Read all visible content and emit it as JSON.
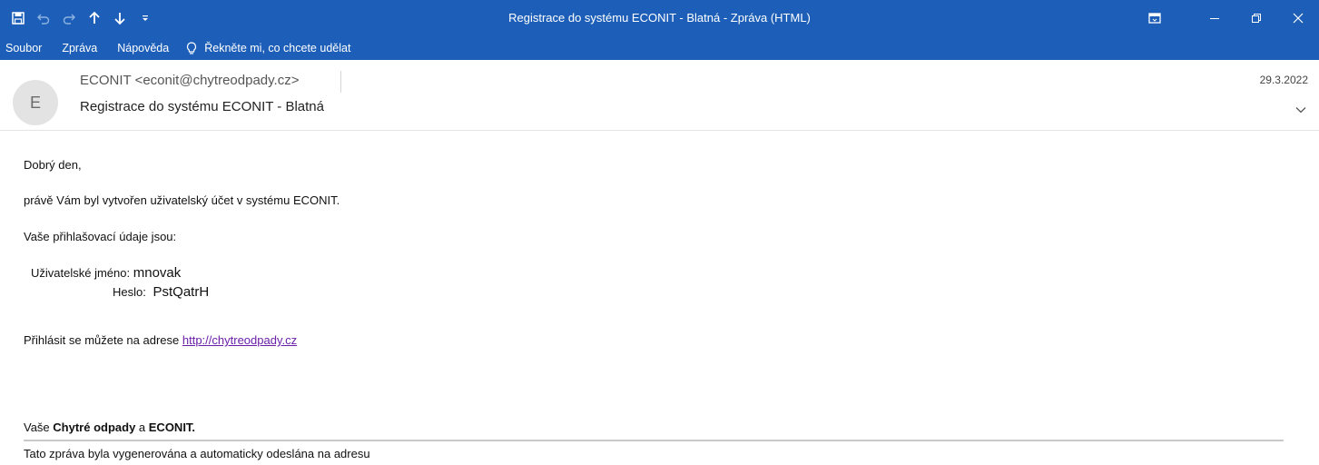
{
  "window": {
    "title": "Registrace do systému ECONIT - Blatná  -  Zpráva (HTML)"
  },
  "quick_access": {
    "save_icon": "save-icon",
    "undo_icon": "undo-icon",
    "redo_icon": "redo-icon",
    "up_icon": "arrow-up-icon",
    "down_icon": "arrow-down-icon",
    "customize_icon": "customize-icon"
  },
  "menu": {
    "items": [
      "Soubor",
      "Zpráva",
      "Nápověda"
    ],
    "tell_me": "Řekněte mi, co chcete udělat"
  },
  "message": {
    "avatar_initial": "E",
    "sender": "ECONIT <econit@chytreodpady.cz>",
    "subject": "Registrace do systému ECONIT - Blatná",
    "date": "29.3.2022"
  },
  "body": {
    "greeting": "Dobrý den,",
    "line1": "právě Vám byl vytvořen uživatelský účet v systému ECONIT.",
    "line2": "Vaše přihlašovací údaje jsou:",
    "username_label": "Uživatelské jméno:",
    "username_value": "mnovak",
    "password_label": "Heslo:",
    "password_value": "PstQatrH",
    "login_prefix": "Přihlásit se můžete na adrese ",
    "login_link": "http://chytreodpady.cz",
    "sig_prefix": "Vaše ",
    "sig_brand": "Chytré odpady",
    "sig_mid": " a ",
    "sig_company": "ECONIT.",
    "footer": "Tato zpráva byla vygenerována a automaticky odeslána na adresu"
  },
  "colors": {
    "titlebar": "#1d5fb8",
    "link": "#6b1ea8"
  }
}
